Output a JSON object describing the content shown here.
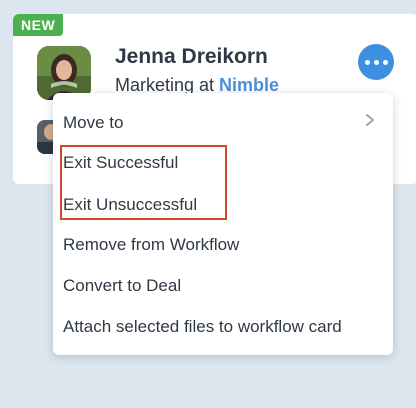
{
  "badge": "NEW",
  "contact": {
    "name": "Jenna Dreikorn",
    "role_prefix": "Marketing at ",
    "company": "Nimble"
  },
  "menu": {
    "items": [
      {
        "label": "Move to"
      },
      {
        "label": "Exit Successful"
      },
      {
        "label": "Exit Unsuccessful"
      },
      {
        "label": "Remove from Workflow"
      },
      {
        "label": "Convert to Deal"
      },
      {
        "label": "Attach selected files to workflow card"
      }
    ]
  },
  "icons": {
    "more": "more-horizontal-icon",
    "submenu": "chevron-right-icon"
  },
  "colors": {
    "badge": "#4caf50",
    "accent": "#3d8fe0",
    "company_link": "#4a90d9",
    "highlight_border": "#d0492f",
    "background": "#dde6ef"
  }
}
